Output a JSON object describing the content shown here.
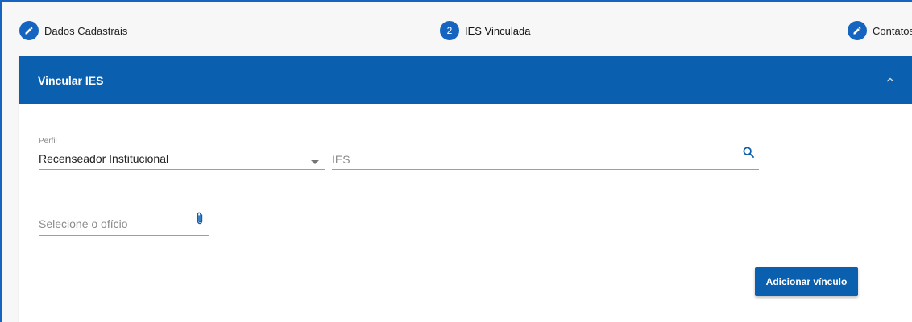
{
  "stepper": {
    "steps": [
      {
        "number": "",
        "label": "Dados Cadastrais",
        "icon": "pencil-icon"
      },
      {
        "number": "2",
        "label": "IES Vinculada",
        "icon": ""
      },
      {
        "number": "",
        "label": "Contatos",
        "icon": "pencil-icon"
      }
    ]
  },
  "panel": {
    "title": "Vincular IES",
    "chevron_icon": "chevron-up-icon"
  },
  "form": {
    "perfil": {
      "label": "Perfil",
      "value": "Recenseador Institucional",
      "icon": "dropdown-arrow-icon"
    },
    "ies": {
      "placeholder": "IES",
      "icon": "search-icon"
    },
    "oficio": {
      "placeholder": "Selecione o ofício",
      "icon": "paperclip-icon"
    }
  },
  "actions": {
    "add_label": "Adicionar vínculo"
  },
  "colors": {
    "primary": "#0a5fae",
    "step_circle": "#1565c0",
    "frame_border": "#1565c0"
  }
}
